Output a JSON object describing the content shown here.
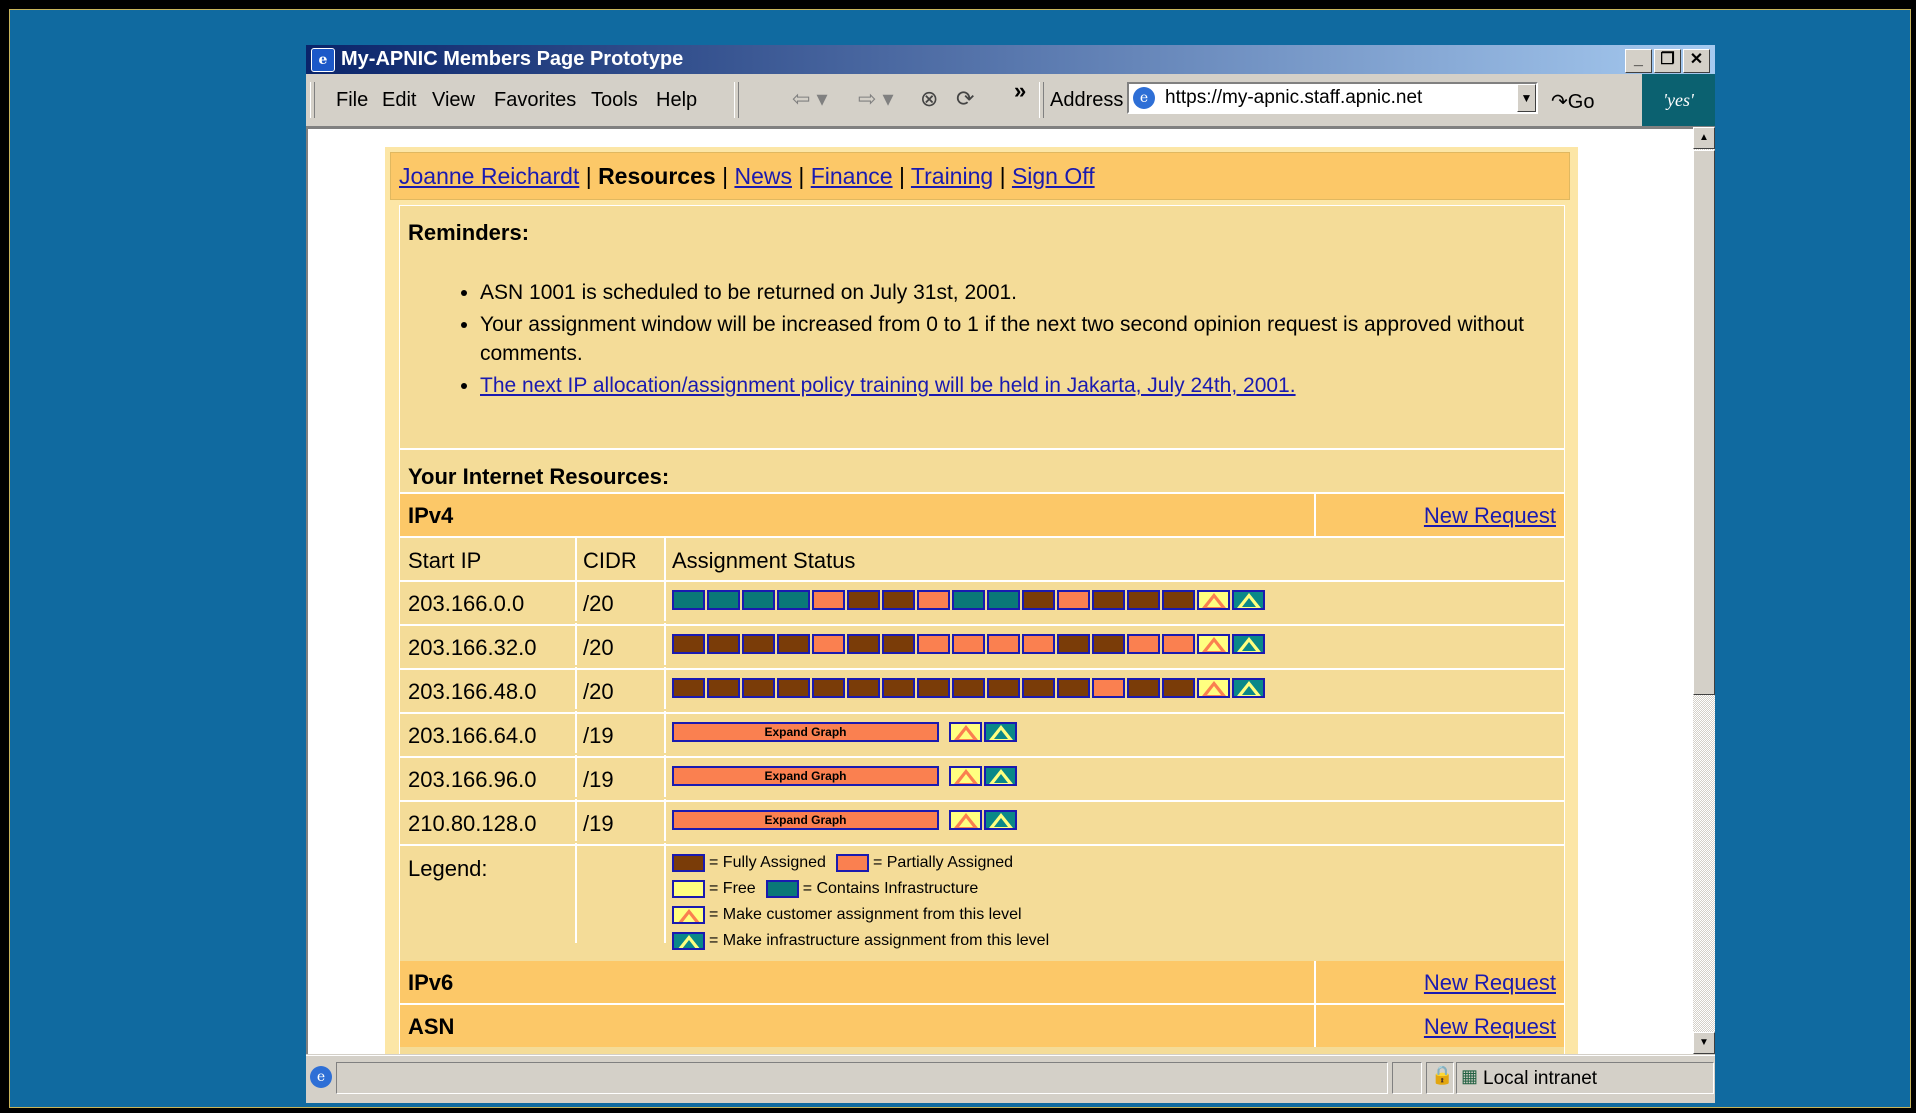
{
  "window": {
    "title": "My-APNIC Members Page Prototype"
  },
  "menu": {
    "items": [
      "File",
      "Edit",
      "View",
      "Favorites",
      "Tools",
      "Help"
    ]
  },
  "toolbar": {
    "address_label": "Address",
    "url": "https://my-apnic.staff.apnic.net",
    "go_label": "Go",
    "chevron": "»",
    "brand": "'yes'"
  },
  "nav": {
    "user": "Joanne Reichardt",
    "current": "Resources",
    "links": [
      "News",
      "Finance",
      "Training",
      "Sign Off"
    ],
    "sep": "|"
  },
  "reminders": {
    "heading": "Reminders:",
    "items": [
      "ASN 1001 is scheduled to be returned on July 31st, 2001.",
      "Your assignment window will be increased from 0 to 1 if the next two second opinion request is approved without comments."
    ],
    "link": "The next IP allocation/assignment policy training will be held in Jakarta, July 24th, 2001."
  },
  "resources": {
    "heading": "Your Internet Resources:",
    "ipv4": {
      "title": "IPv4",
      "new_request": "New Request",
      "columns": [
        "Start IP",
        "CIDR",
        "Assignment Status"
      ],
      "rows": [
        {
          "ip": "203.166.0.0",
          "cidr": "/20",
          "status": [
            "inf",
            "inf",
            "inf",
            "inf",
            "p",
            "f",
            "f",
            "p",
            "inf",
            "inf",
            "f",
            "p",
            "f",
            "f",
            "f",
            "c",
            "i"
          ]
        },
        {
          "ip": "203.166.32.0",
          "cidr": "/20",
          "status": [
            "f",
            "f",
            "f",
            "f",
            "p",
            "f",
            "f",
            "p",
            "p",
            "p",
            "p",
            "f",
            "f",
            "p",
            "p",
            "c",
            "i"
          ]
        },
        {
          "ip": "203.166.48.0",
          "cidr": "/20",
          "status": [
            "f",
            "f",
            "f",
            "f",
            "f",
            "f",
            "f",
            "f",
            "f",
            "f",
            "f",
            "f",
            "p",
            "f",
            "f",
            "c",
            "i"
          ]
        },
        {
          "ip": "203.166.64.0",
          "cidr": "/19",
          "status": "expand"
        },
        {
          "ip": "203.166.96.0",
          "cidr": "/19",
          "status": "expand"
        },
        {
          "ip": "210.80.128.0",
          "cidr": "/19",
          "status": "expand"
        }
      ],
      "expand_label": "Expand Graph",
      "legend_label": "Legend:",
      "legend": {
        "fully": "= Fully Assigned",
        "partial": "= Partially Assigned",
        "free": "= Free",
        "infra": "= Contains Infrastructure",
        "cust": "= Make customer assignment from this level",
        "infra_assign": "= Make infrastructure assignment from this level"
      }
    },
    "ipv6": {
      "title": "IPv6",
      "new_request": "New Request"
    },
    "asn": {
      "title": "ASN",
      "new_request": "New Request"
    }
  },
  "status": {
    "zone": "Local intranet"
  },
  "colors": {
    "fully": "#7a3c08",
    "partial": "#fa8050",
    "free": "#ffff80",
    "infra": "#0a7878",
    "link": "#1a1ab0",
    "band": "#fcc868",
    "panel": "#f4dc98"
  }
}
